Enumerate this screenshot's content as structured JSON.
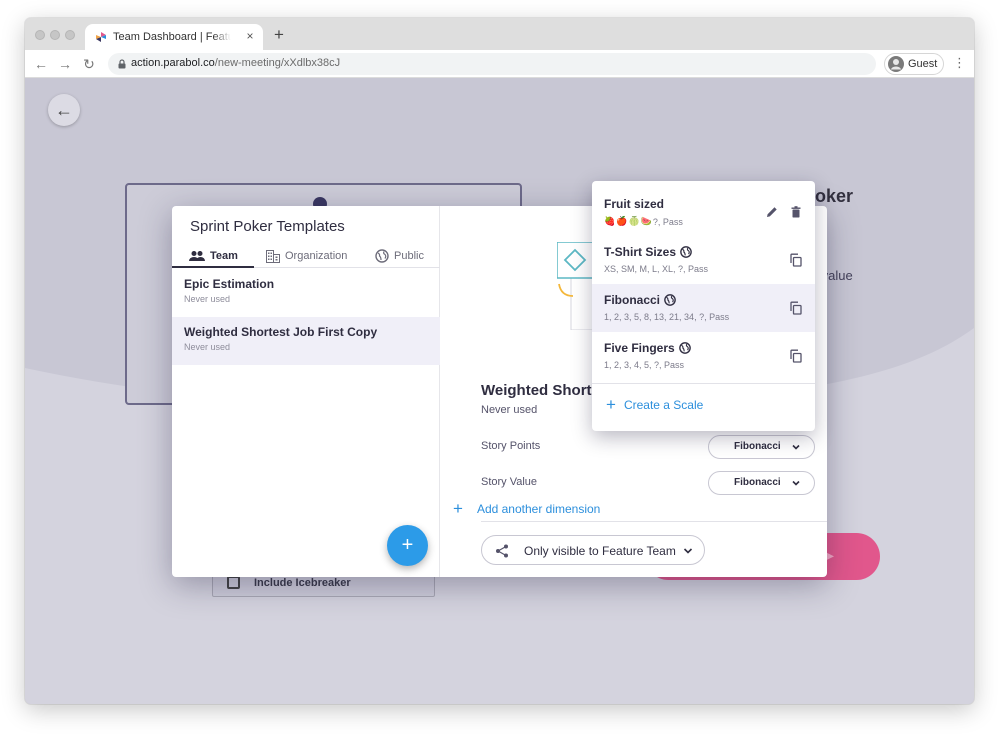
{
  "browser": {
    "tab_title": "Team Dashboard | Feature Team",
    "tab_close": "×",
    "new_tab": "+",
    "url_host": "action.parabol.co",
    "url_path": "/new-meeting/xXdlbx38cJ",
    "profile_label": "Guest",
    "menu_glyph": "⋮",
    "back_glyph": "←",
    "forward_glyph": "→",
    "reload_glyph": "↻"
  },
  "background": {
    "heading": "oker",
    "subtext": "/value",
    "checkbox_label": "Include Icebreaker"
  },
  "page": {
    "back_glyph": "←"
  },
  "templates_panel": {
    "title": "Sprint Poker Templates",
    "tabs": [
      {
        "label": "Team",
        "icon": "team-icon",
        "active": true
      },
      {
        "label": "Organization",
        "icon": "organization-icon",
        "active": false
      },
      {
        "label": "Public",
        "icon": "globe-icon",
        "active": false
      }
    ],
    "templates": [
      {
        "name": "Epic Estimation",
        "meta": "Never used",
        "selected": false
      },
      {
        "name": "Weighted Shortest Job First Copy",
        "meta": "Never used",
        "selected": true
      }
    ],
    "add_glyph": "+"
  },
  "template_detail": {
    "title": "Weighted Shortest Job First Copy",
    "meta": "Never used",
    "dimensions": [
      {
        "label": "Story Points",
        "scale": "Fibonacci"
      },
      {
        "label": "Story Value",
        "scale": "Fibonacci"
      }
    ],
    "add_dimension_label": "Add another dimension",
    "add_glyph": "+",
    "sharing_label": "Only visible to Feature Team"
  },
  "scale_menu": {
    "scales": [
      {
        "name": "Fruit sized",
        "emojis": [
          "🍓",
          "🍎",
          "🍈",
          "🍉"
        ],
        "values": "?, Pass",
        "public": false,
        "actions": [
          "edit",
          "delete"
        ],
        "hover": false
      },
      {
        "name": "T-Shirt Sizes",
        "emojis": [],
        "values": "XS, SM, M, L, XL, ?, Pass",
        "public": true,
        "actions": [
          "copy"
        ],
        "hover": false
      },
      {
        "name": "Fibonacci",
        "emojis": [],
        "values": "1, 2, 3, 5, 8, 13, 21, 34, ?, Pass",
        "public": true,
        "actions": [
          "copy"
        ],
        "hover": true
      },
      {
        "name": "Five Fingers",
        "emojis": [],
        "values": "1, 2, 3, 4, 5, ?, Pass",
        "public": true,
        "actions": [
          "copy"
        ],
        "hover": false
      }
    ],
    "create_label": "Create a Scale",
    "create_glyph": "+"
  },
  "colors": {
    "accent_blue": "#2c8fdc",
    "fab_blue": "#2c9be8",
    "primary_pink": "#e1578c",
    "text_dark": "#2f2d40",
    "backdrop": "#c8c7d4",
    "selected_row": "#f0eff8"
  }
}
